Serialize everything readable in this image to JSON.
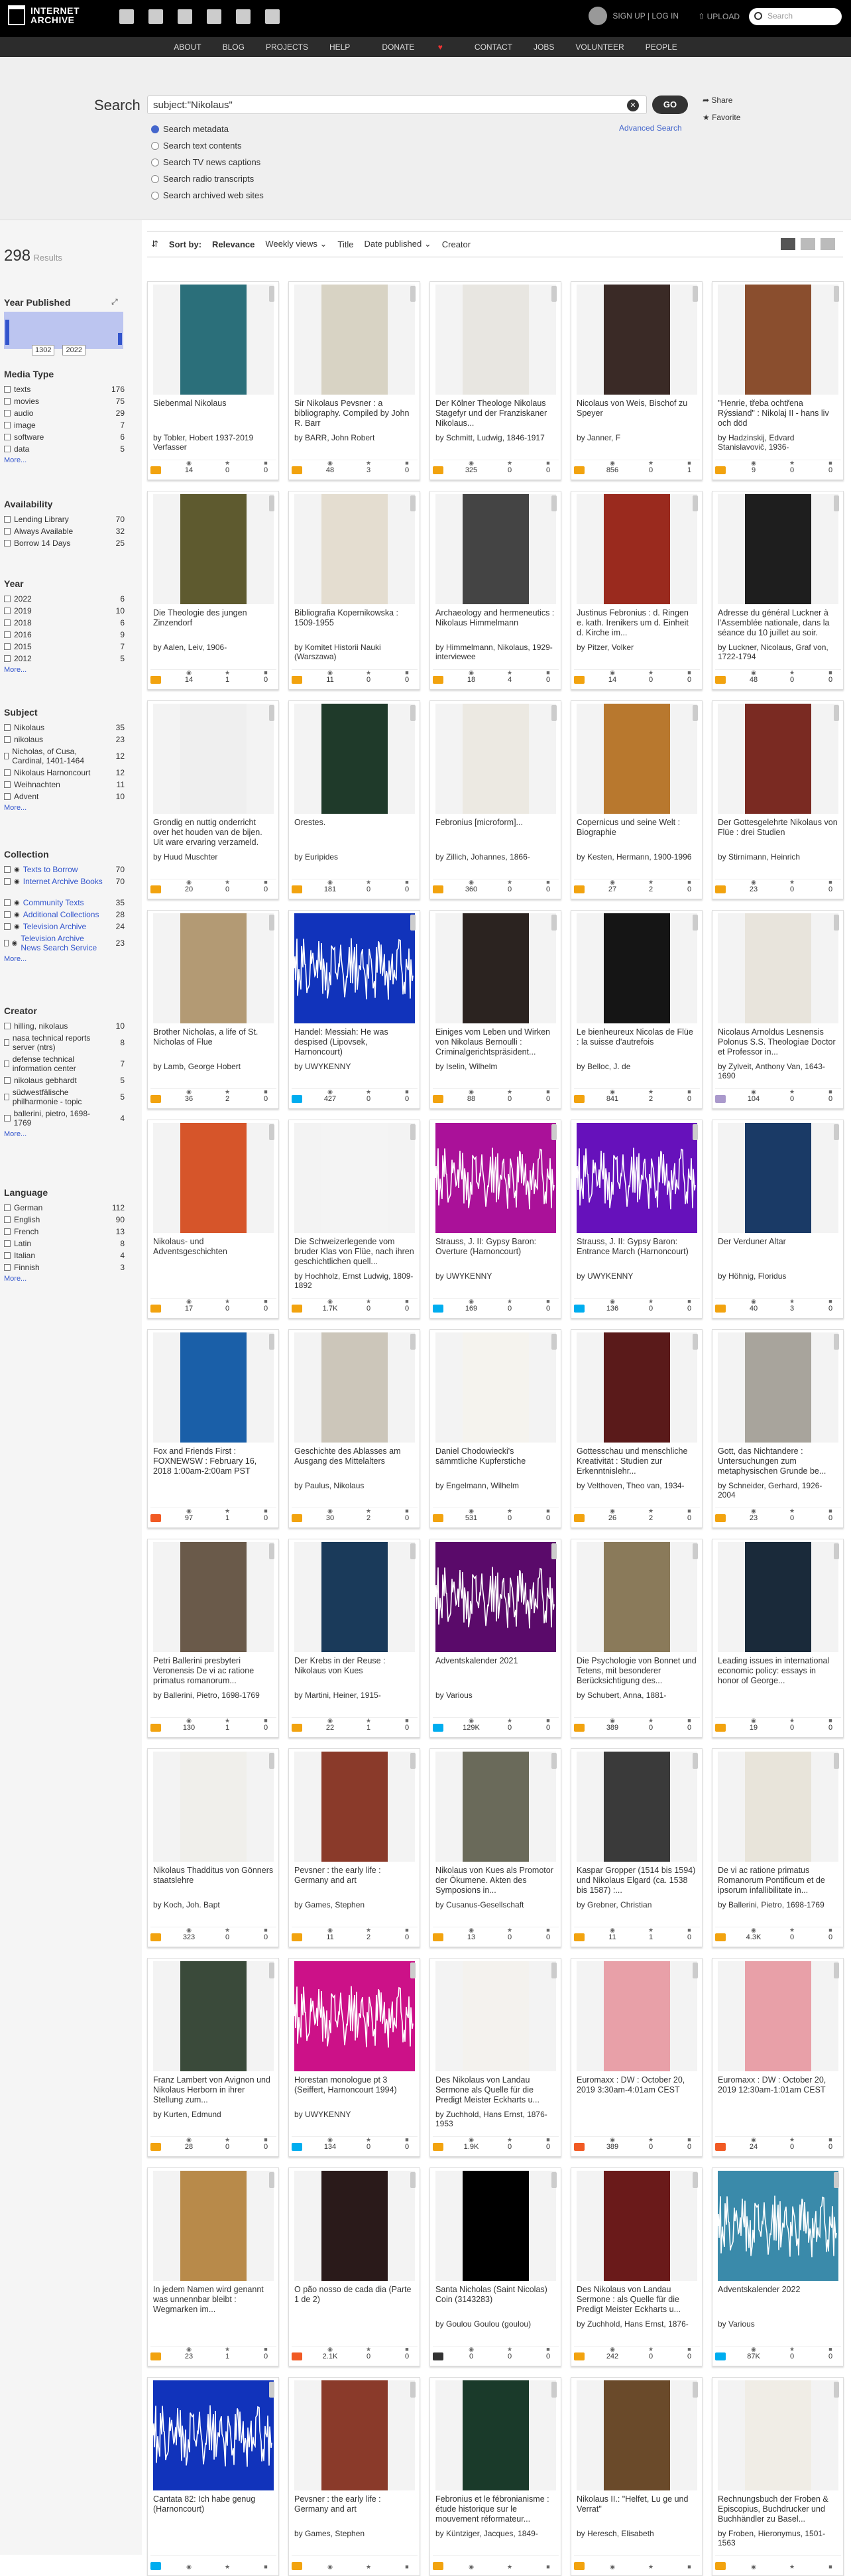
{
  "header": {
    "logo_line1": "INTERNET",
    "logo_line2": "ARCHIVE",
    "signup_login": "SIGN UP | LOG IN",
    "upload": "UPLOAD",
    "search_placeholder": "Search"
  },
  "subnav": [
    "ABOUT",
    "BLOG",
    "PROJECTS",
    "HELP",
    "DONATE",
    "CONTACT",
    "JOBS",
    "VOLUNTEER",
    "PEOPLE"
  ],
  "search": {
    "label": "Search",
    "query": "subject:\"Nikolaus\"",
    "go": "GO",
    "share": "Share",
    "favorite": "Favorite",
    "advanced": "Advanced Search",
    "options": [
      {
        "label": "Search metadata",
        "selected": true
      },
      {
        "label": "Search text contents",
        "selected": false
      },
      {
        "label": "Search TV news captions",
        "selected": false
      },
      {
        "label": "Search radio transcripts",
        "selected": false
      },
      {
        "label": "Search archived web sites",
        "selected": false
      }
    ]
  },
  "results": {
    "count": "298",
    "label": "Results"
  },
  "facets": {
    "year_published": {
      "heading": "Year Published",
      "from": "1302",
      "to": "2022"
    },
    "media_type": {
      "heading": "Media Type",
      "items": [
        {
          "label": "texts",
          "count": "176"
        },
        {
          "label": "movies",
          "count": "75"
        },
        {
          "label": "audio",
          "count": "29"
        },
        {
          "label": "image",
          "count": "7"
        },
        {
          "label": "software",
          "count": "6"
        },
        {
          "label": "data",
          "count": "5"
        }
      ],
      "more": "More..."
    },
    "availability": {
      "heading": "Availability",
      "items": [
        {
          "label": "Lending Library",
          "count": "70"
        },
        {
          "label": "Always Available",
          "count": "32"
        },
        {
          "label": "Borrow 14 Days",
          "count": "25"
        }
      ]
    },
    "year": {
      "heading": "Year",
      "items": [
        {
          "label": "2022",
          "count": "6"
        },
        {
          "label": "2019",
          "count": "10"
        },
        {
          "label": "2018",
          "count": "6"
        },
        {
          "label": "2016",
          "count": "9"
        },
        {
          "label": "2015",
          "count": "7"
        },
        {
          "label": "2012",
          "count": "5"
        }
      ],
      "more": "More..."
    },
    "subject": {
      "heading": "Subject",
      "items": [
        {
          "label": "Nikolaus",
          "count": "35"
        },
        {
          "label": "nikolaus",
          "count": "23"
        },
        {
          "label": "Nicholas, of Cusa, Cardinal, 1401-1464",
          "count": "12"
        },
        {
          "label": "Nikolaus Harnoncourt",
          "count": "12"
        },
        {
          "label": "Weihnachten",
          "count": "11"
        },
        {
          "label": "Advent",
          "count": "10"
        }
      ],
      "more": "More..."
    },
    "collection": {
      "heading": "Collection",
      "items": [
        {
          "label": "Texts to Borrow",
          "count": "70"
        },
        {
          "label": "Internet Archive Books",
          "count": "70"
        },
        {
          "label": "Community Texts",
          "count": "35"
        },
        {
          "label": "Additional Collections",
          "count": "28"
        },
        {
          "label": "Television Archive",
          "count": "24"
        },
        {
          "label": "Television Archive News Search Service",
          "count": "23"
        }
      ],
      "more": "More..."
    },
    "creator": {
      "heading": "Creator",
      "items": [
        {
          "label": "hilling, nikolaus",
          "count": "10"
        },
        {
          "label": "nasa technical reports server (ntrs)",
          "count": "8"
        },
        {
          "label": "defense technical information center",
          "count": "7"
        },
        {
          "label": "nikolaus gebhardt",
          "count": "5"
        },
        {
          "label": "südwestfälische philharmonie - topic",
          "count": "5"
        },
        {
          "label": "ballerini, pietro, 1698-1769",
          "count": "4"
        }
      ],
      "more": "More..."
    },
    "language": {
      "heading": "Language",
      "items": [
        {
          "label": "German",
          "count": "112"
        },
        {
          "label": "English",
          "count": "90"
        },
        {
          "label": "French",
          "count": "13"
        },
        {
          "label": "Latin",
          "count": "8"
        },
        {
          "label": "Italian",
          "count": "4"
        },
        {
          "label": "Finnish",
          "count": "3"
        }
      ],
      "more": "More..."
    }
  },
  "sortbar": {
    "sort_by": "Sort by:",
    "relevance": "Relevance",
    "weekly_views": "Weekly views",
    "title": "Title",
    "date_published": "Date published",
    "creator": "Creator"
  },
  "cards": [
    {
      "title": "Siebenmal Nikolaus",
      "creator": "by Tobler, Hobert 1937-2019 Verfasser",
      "type": "texts",
      "views": "14",
      "favs": "0",
      "reviews": "0",
      "cover": "#2b6f7a"
    },
    {
      "title": "Sir Nikolaus Pevsner : a bibliography. Compiled by John R. Barr",
      "creator": "by BARR, John Robert",
      "type": "texts",
      "views": "48",
      "favs": "3",
      "reviews": "0",
      "cover": "#d8d3c4"
    },
    {
      "title": "Der Kölner Theologe Nikolaus Stagefyr und der Franziskaner Nikolaus...",
      "creator": "by Schmitt, Ludwig, 1846-1917",
      "type": "texts",
      "views": "325",
      "favs": "0",
      "reviews": "0",
      "cover": "#e8e6e1"
    },
    {
      "title": "Nicolaus von Weis, Bischof zu Speyer",
      "creator": "by Janner, F",
      "type": "texts",
      "views": "856",
      "favs": "0",
      "reviews": "1",
      "cover": "#3a2a26"
    },
    {
      "title": "\"Henrie, třeba ochtřena Rýssiand\" : Nikolaj II - hans liv och död",
      "creator": "by Hadzinskij, Edvard Stanislavovič, 1936-",
      "type": "texts",
      "views": "9",
      "favs": "0",
      "reviews": "0",
      "cover": "#8a4e2e"
    },
    {
      "title": "Die Theologie des jungen Zinzendorf",
      "creator": "by Aalen, Leiv, 1906-",
      "type": "texts",
      "views": "14",
      "favs": "1",
      "reviews": "0",
      "cover": "#5e5a2f"
    },
    {
      "title": "Bibliografia Kopernikowska : 1509-1955",
      "creator": "by Komitet Historii Nauki (Warszawa)",
      "type": "texts",
      "views": "11",
      "favs": "0",
      "reviews": "0",
      "cover": "#e4ddd0"
    },
    {
      "title": "Archaeology and hermeneutics : Nikolaus Himmelmann",
      "creator": "by Himmelmann, Nikolaus, 1929- interviewee",
      "type": "texts",
      "views": "18",
      "favs": "4",
      "reviews": "0",
      "cover": "#444444"
    },
    {
      "title": "Justinus Febronius : d. Ringen e. kath. Irenikers um d. Einheit d. Kirche im...",
      "creator": "by Pitzer, Volker",
      "type": "texts",
      "views": "14",
      "favs": "0",
      "reviews": "0",
      "cover": "#9a2a1e"
    },
    {
      "title": "Adresse du général Luckner à l'Assemblée nationale, dans la séance du 10 juillet au soir.",
      "creator": "by Luckner, Nicolaus, Graf von, 1722-1794",
      "type": "texts",
      "views": "48",
      "favs": "0",
      "reviews": "0",
      "cover": "#1e1e1e"
    },
    {
      "title": "Grondig en nuttig onderricht over het houden van de bijen. Uit ware ervaring verzameld.",
      "creator": "by Huud Muschter",
      "type": "texts",
      "views": "20",
      "favs": "0",
      "reviews": "0",
      "cover": "#efefef"
    },
    {
      "title": "Orestes.",
      "creator": "by Euripides",
      "type": "texts",
      "views": "181",
      "favs": "0",
      "reviews": "0",
      "cover": "#1f3a2a"
    },
    {
      "title": "Febronius [microform]...",
      "creator": "by Zillich, Johannes, 1866-",
      "type": "texts",
      "views": "360",
      "favs": "0",
      "reviews": "0",
      "cover": "#ece9e2"
    },
    {
      "title": "Copernicus und seine Welt : Biographie",
      "creator": "by Kesten, Hermann, 1900-1996",
      "type": "texts",
      "views": "27",
      "favs": "2",
      "reviews": "0",
      "cover": "#b8782e"
    },
    {
      "title": "Der Gottesgelehrte Nikolaus von Flüe : drei Studien",
      "creator": "by Stirnimann, Heinrich",
      "type": "texts",
      "views": "23",
      "favs": "0",
      "reviews": "0",
      "cover": "#7a2a22"
    },
    {
      "title": "Brother Nicholas, a life of St. Nicholas of Flue",
      "creator": "by Lamb, George Hobert",
      "type": "texts",
      "views": "36",
      "favs": "2",
      "reviews": "0",
      "cover": "#b39a74"
    },
    {
      "title": "Handel: Messiah: He was despised (Lipovsek, Harnoncourt)",
      "creator": "by UWYKENNY",
      "type": "audio",
      "views": "427",
      "favs": "0",
      "reviews": "0",
      "cover": "#1133bb"
    },
    {
      "title": "Einiges vom Leben und Wirken von Nikolaus Bernoulli : Criminalgerichtspräsident...",
      "creator": "by Iselin, Wilhelm",
      "type": "texts",
      "views": "88",
      "favs": "0",
      "reviews": "0",
      "cover": "#2b2320"
    },
    {
      "title": "Le bienheureux Nicolas de Flüe : la suisse d'autrefois",
      "creator": "by Belloc, J. de",
      "type": "texts",
      "views": "841",
      "favs": "2",
      "reviews": "0",
      "cover": "#151515"
    },
    {
      "title": "Nicolaus Arnoldus Lesnensis Polonus S.S. Theologiae Doctor et Professor in...",
      "creator": "by Zylveit, Anthony Van, 1643-1690",
      "type": "image",
      "views": "104",
      "favs": "0",
      "reviews": "0",
      "cover": "#e8e4dc"
    },
    {
      "title": "Nikolaus- und Adventsgeschichten",
      "creator": "",
      "type": "texts",
      "views": "17",
      "favs": "0",
      "reviews": "0",
      "cover": "#d6552a"
    },
    {
      "title": "Die Schweizerlegende vom bruder Klas von Flüe, nach ihren geschichtlichen quell...",
      "creator": "by Hochholz, Ernst Ludwig, 1809-1892",
      "type": "texts",
      "views": "1.7K",
      "favs": "0",
      "reviews": "0",
      "cover": "#f4f4f4"
    },
    {
      "title": "Strauss, J. II: Gypsy Baron: Overture (Harnoncourt)",
      "creator": "by UWYKENNY",
      "type": "audio",
      "views": "169",
      "favs": "0",
      "reviews": "0",
      "cover": "#aa1199"
    },
    {
      "title": "Strauss, J. II: Gypsy Baron: Entrance March (Harnoncourt)",
      "creator": "by UWYKENNY",
      "type": "audio",
      "views": "136",
      "favs": "0",
      "reviews": "0",
      "cover": "#6611bb"
    },
    {
      "title": "Der Verduner Altar",
      "creator": "by Höhnig, Floridus",
      "type": "texts",
      "views": "40",
      "favs": "3",
      "reviews": "0",
      "cover": "#1a3a66"
    },
    {
      "title": "Fox and Friends First : FOXNEWSW : February 16, 2018 1:00am-2:00am PST",
      "creator": "",
      "type": "movies",
      "views": "97",
      "favs": "1",
      "reviews": "0",
      "cover": "#1a5fa8"
    },
    {
      "title": "Geschichte des Ablasses am Ausgang des Mittelalters",
      "creator": "by Paulus, Nikolaus",
      "type": "texts",
      "views": "30",
      "favs": "2",
      "reviews": "0",
      "cover": "#ccc6ba"
    },
    {
      "title": "Daniel Chodowiecki's sämmtliche Kupferstiche",
      "creator": "by Engelmann, Wilhelm",
      "type": "texts",
      "views": "531",
      "favs": "0",
      "reviews": "0",
      "cover": "#f5f3ee"
    },
    {
      "title": "Gottesschau und menschliche Kreativität : Studien zur Erkenntnislehr...",
      "creator": "by Velthoven, Theo van, 1934-",
      "type": "texts",
      "views": "26",
      "favs": "2",
      "reviews": "0",
      "cover": "#5a1a1a"
    },
    {
      "title": "Gott, das Nichtandere : Untersuchungen zum metaphysischen Grunde be...",
      "creator": "by Schneider, Gerhard, 1926-2004",
      "type": "texts",
      "views": "23",
      "favs": "0",
      "reviews": "0",
      "cover": "#a8a49c"
    },
    {
      "title": "Petri Ballerini presbyteri Veronensis De vi ac ratione primatus romanorum...",
      "creator": "by Ballerini, Pietro, 1698-1769",
      "type": "texts",
      "views": "130",
      "favs": "1",
      "reviews": "0",
      "cover": "#6a5a4a"
    },
    {
      "title": "Der Krebs in der Reuse : Nikolaus von Kues",
      "creator": "by Martini, Heiner, 1915-",
      "type": "texts",
      "views": "22",
      "favs": "1",
      "reviews": "0",
      "cover": "#1a3a5a"
    },
    {
      "title": "Adventskalender 2021",
      "creator": "by Various",
      "type": "audio",
      "views": "129K",
      "favs": "0",
      "reviews": "0",
      "cover": "#5a0a6a"
    },
    {
      "title": "Die Psychologie von Bonnet und Tetens, mit besonderer Berücksichtigung des...",
      "creator": "by Schubert, Anna, 1881-",
      "type": "texts",
      "views": "389",
      "favs": "0",
      "reviews": "0",
      "cover": "#8a7a5a"
    },
    {
      "title": "Leading issues in international economic policy: essays in honor of George...",
      "creator": "",
      "type": "texts",
      "views": "19",
      "favs": "0",
      "reviews": "0",
      "cover": "#1a2a3a"
    },
    {
      "title": "Nikolaus Thadditus von Gönners staatslehre",
      "creator": "by Koch, Joh. Bapt",
      "type": "texts",
      "views": "323",
      "favs": "0",
      "reviews": "0",
      "cover": "#f0efeb"
    },
    {
      "title": "Pevsner : the early life : Germany and art",
      "creator": "by Games, Stephen",
      "type": "texts",
      "views": "11",
      "favs": "2",
      "reviews": "0",
      "cover": "#8a3a2a"
    },
    {
      "title": "Nikolaus von Kues als Promotor der Ökumene. Akten des Symposions in...",
      "creator": "by Cusanus-Gesellschaft",
      "type": "texts",
      "views": "13",
      "favs": "0",
      "reviews": "0",
      "cover": "#6a6a5a"
    },
    {
      "title": "Kaspar Gropper (1514 bis 1594) und Nikolaus Elgard (ca. 1538 bis 1587) :...",
      "creator": "by Grebner, Christian",
      "type": "texts",
      "views": "11",
      "favs": "1",
      "reviews": "0",
      "cover": "#3a3a3a"
    },
    {
      "title": "De vi ac ratione primatus Romanorum Pontificum et de ipsorum infallibilitate in...",
      "creator": "by Ballerini, Pietro, 1698-1769",
      "type": "texts",
      "views": "4.3K",
      "favs": "0",
      "reviews": "0",
      "cover": "#e8e4da"
    },
    {
      "title": "Franz Lambert von Avignon und Nikolaus Herborn in ihrer Stellung zum...",
      "creator": "by Kurten, Edmund",
      "type": "texts",
      "views": "28",
      "favs": "0",
      "reviews": "0",
      "cover": "#3a4a3a"
    },
    {
      "title": "Horestan monologue pt 3 (Seiffert, Harnoncourt 1994)",
      "creator": "by UWYKENNY",
      "type": "audio",
      "views": "134",
      "favs": "0",
      "reviews": "0",
      "cover": "#cc1188"
    },
    {
      "title": "Des Nikolaus von Landau Sermone als Quelle für die Predigt Meister Eckharts u...",
      "creator": "by Zuchhold, Hans Ernst, 1876-1953",
      "type": "texts",
      "views": "1.9K",
      "favs": "0",
      "reviews": "0",
      "cover": "#f4f2ee"
    },
    {
      "title": "Euromaxx : DW : October 20, 2019 3:30am-4:01am CEST",
      "creator": "",
      "type": "movies",
      "views": "389",
      "favs": "0",
      "reviews": "0",
      "cover": "#e8a0a8"
    },
    {
      "title": "Euromaxx : DW : October 20, 2019 12:30am-1:01am CEST",
      "creator": "",
      "type": "movies",
      "views": "24",
      "favs": "0",
      "reviews": "0",
      "cover": "#e8a0a8"
    },
    {
      "title": "In jedem Namen wird genannt was unnennbar bleibt : Wegmarken im...",
      "creator": "",
      "type": "texts",
      "views": "23",
      "favs": "1",
      "reviews": "0",
      "cover": "#b88a4a"
    },
    {
      "title": "O pão nosso de cada dia (Parte 1 de 2)",
      "creator": "",
      "type": "movies",
      "views": "2.1K",
      "favs": "0",
      "reviews": "0",
      "cover": "#2a1a1a"
    },
    {
      "title": "Santa Nicholas (Saint Nicolas) Coin (3143283)",
      "creator": "by Goulou Goulou (goulou)",
      "type": "data",
      "views": "0",
      "favs": "0",
      "reviews": "0",
      "cover": "#000000"
    },
    {
      "title": "Des Nikolaus von Landau Sermone : als Quelle für die Predigt Meister Eckharts u...",
      "creator": "by Zuchhold, Hans Ernst, 1876-",
      "type": "texts",
      "views": "242",
      "favs": "0",
      "reviews": "0",
      "cover": "#6a1a1a"
    },
    {
      "title": "Adventskalender 2022",
      "creator": "by Various",
      "type": "audio",
      "views": "87K",
      "favs": "0",
      "reviews": "0",
      "cover": "#3a8aaa"
    },
    {
      "title": "Cantata 82: Ich habe genug (Harnoncourt)",
      "creator": "",
      "type": "audio",
      "views": "",
      "favs": "",
      "reviews": "",
      "cover": "#1133bb"
    },
    {
      "title": "Pevsner : the early life : Germany and art",
      "creator": "by Games, Stephen",
      "type": "texts",
      "views": "",
      "favs": "",
      "reviews": "",
      "cover": "#8a3a2a"
    },
    {
      "title": "Febronius et le fébronianisme : étude historique sur le mouvement réformateur...",
      "creator": "by Küntziger, Jacques, 1849-",
      "type": "texts",
      "views": "",
      "favs": "",
      "reviews": "",
      "cover": "#1a3a2a"
    },
    {
      "title": "Nikolaus II.: \"Helfet, Lu ge und Verrat\"",
      "creator": "by Heresch, Elisabeth",
      "type": "texts",
      "views": "",
      "favs": "",
      "reviews": "",
      "cover": "#6a4a2a"
    },
    {
      "title": "Rechnungsbuch der Froben & Episcopius, Buchdrucker und Buchhändler zu Basel...",
      "creator": "by Froben, Hieronymus, 1501-1563",
      "type": "texts",
      "views": "",
      "favs": "",
      "reviews": "",
      "cover": "#f0ede6"
    }
  ]
}
